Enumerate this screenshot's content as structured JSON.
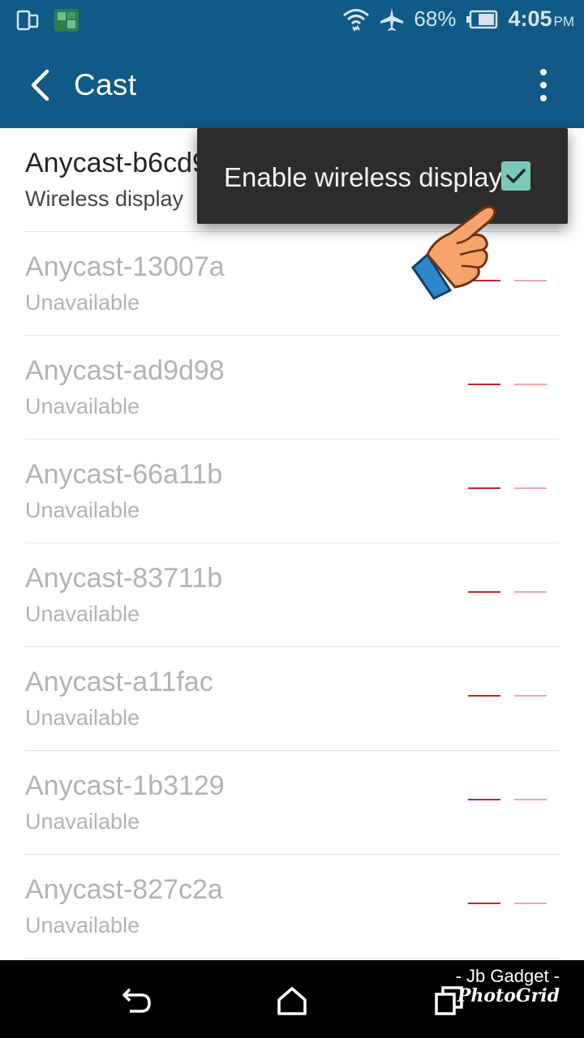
{
  "status_bar": {
    "battery_percent": "68%",
    "time": "4:05",
    "time_suffix": "PM",
    "icons": [
      "screen-mirror-icon",
      "cast-notification-icon",
      "wifi-icon",
      "airplane-mode-icon",
      "battery-icon"
    ]
  },
  "app_bar": {
    "title": "Cast",
    "back_icon": "chevron-left-icon",
    "menu_icon": "overflow-menu-icon"
  },
  "devices": [
    {
      "name": "Anycast-b6cd9",
      "status": "Wireless display",
      "state": "connected"
    },
    {
      "name": "Anycast-13007a",
      "status": "Unavailable",
      "state": "unavailable"
    },
    {
      "name": "Anycast-ad9d98",
      "status": "Unavailable",
      "state": "unavailable"
    },
    {
      "name": "Anycast-66a11b",
      "status": "Unavailable",
      "state": "unavailable"
    },
    {
      "name": "Anycast-83711b",
      "status": "Unavailable",
      "state": "unavailable"
    },
    {
      "name": "Anycast-a11fac",
      "status": "Unavailable",
      "state": "unavailable"
    },
    {
      "name": "Anycast-1b3129",
      "status": "Unavailable",
      "state": "unavailable"
    },
    {
      "name": "Anycast-827c2a",
      "status": "Unavailable",
      "state": "unavailable"
    }
  ],
  "popup_menu": {
    "label": "Enable wireless display",
    "checked": true,
    "checkbox_color": "#7cc8b8"
  },
  "nav_bar": {
    "buttons": [
      "back-icon",
      "home-icon",
      "recents-icon"
    ]
  },
  "watermark": {
    "line1": "- Jb Gadget -",
    "brand": "PhotoGrid"
  },
  "colors": {
    "primary": "#0f5a87",
    "signal_strong": "#c8252b",
    "signal_weak": "#f2a6ad"
  }
}
